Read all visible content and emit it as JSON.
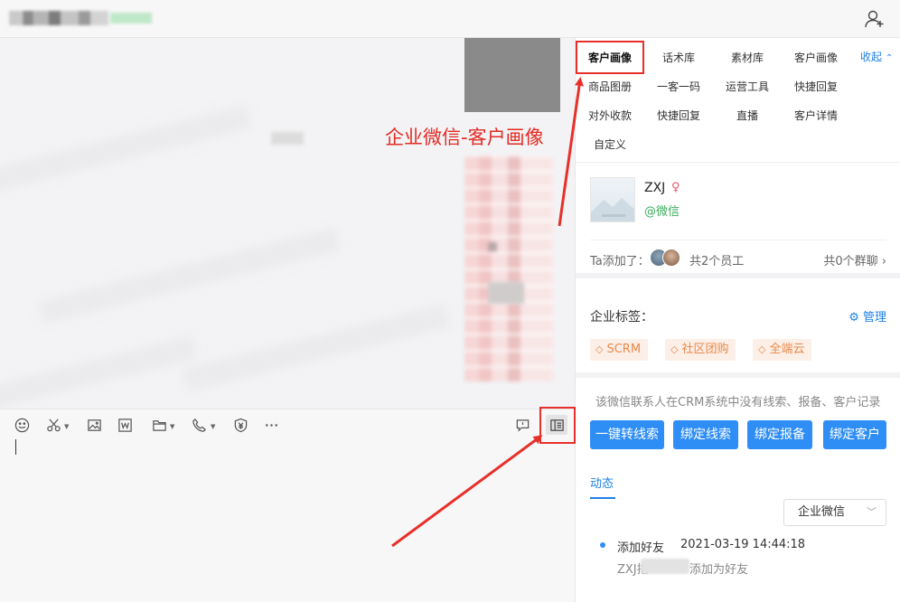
{
  "topbar": {
    "add_icon": "add-user-icon"
  },
  "toolbar": {
    "icons": [
      "emoji-icon",
      "scissors-icon",
      "image-icon",
      "word-doc-icon",
      "folder-icon",
      "phone-icon",
      "payment-icon",
      "more-icon",
      "feedback-icon",
      "sidebar-panel-icon"
    ]
  },
  "panel": {
    "tabs": [
      {
        "label": "客户画像",
        "active": true
      },
      {
        "label": "话术库"
      },
      {
        "label": "素材库"
      },
      {
        "label": "客户画像"
      },
      {
        "label": "商品图册"
      },
      {
        "label": "一客一码"
      },
      {
        "label": "运营工具"
      },
      {
        "label": "快捷回复"
      },
      {
        "label": "对外收款"
      },
      {
        "label": "快捷回复"
      },
      {
        "label": "直播"
      },
      {
        "label": "客户详情"
      },
      {
        "label": "自定义"
      }
    ],
    "collapse_label": "收起",
    "customer": {
      "name": "ZXJ",
      "source": "@微信",
      "added_label": "Ta添加了：",
      "staff_count": "共2个员工",
      "group_count": "共0个群聊"
    },
    "tags": {
      "title": "企业标签：",
      "manage_label": "管理",
      "items": [
        "SCRM",
        "社区团购",
        "全端云"
      ]
    },
    "crm": {
      "note": "该微信联系人在CRM系统中没有线索、报备、客户记录",
      "buttons": [
        "一键转线索",
        "绑定线索",
        "绑定报备",
        "绑定客户"
      ]
    },
    "dynamics": {
      "tab_label": "动态",
      "filter_value": "企业微信",
      "event_title": "添加好友",
      "event_time": "2021-03-19 14:44:18",
      "event_desc_prefix": "ZXJ把",
      "event_desc_suffix": "添加为好友"
    }
  },
  "annotation": {
    "text": "企业微信-客户画像",
    "color": "#e32b24"
  },
  "colors": {
    "accent": "#2f8ef5",
    "link": "#1e80e8",
    "tag_bg": "#fcefe7",
    "tag_text": "#e88a4a",
    "wechat_green": "#3aad5c"
  }
}
